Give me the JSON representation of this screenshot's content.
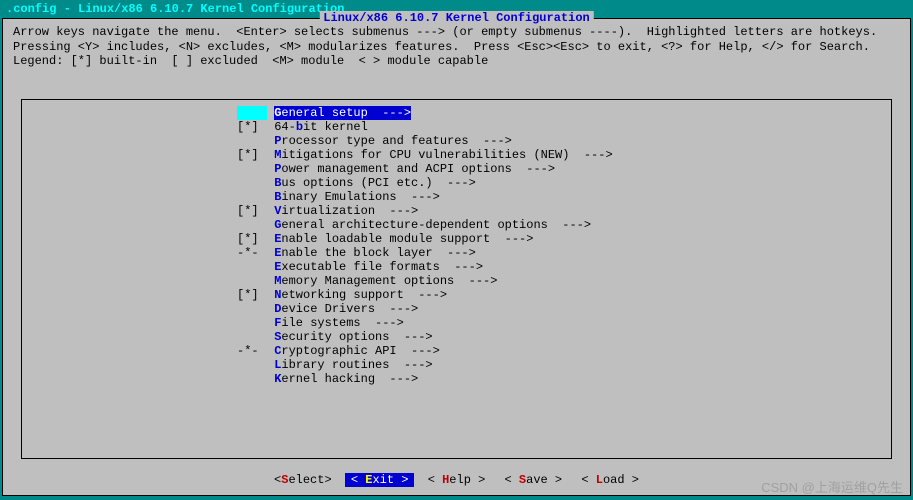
{
  "window_title": ".config - Linux/x86 6.10.7 Kernel Configuration",
  "box_title": "Linux/x86 6.10.7 Kernel Configuration",
  "help_text": "Arrow keys navigate the menu.  <Enter> selects submenus ---> (or empty submenus ----).  Highlighted letters are hotkeys.  Pressing <Y> includes, <N> excludes, <M> modularizes features.  Press <Esc><Esc> to exit, <?> for Help, </> for Search.  Legend: [*] built-in  [ ] excluded  <M> module  < > module capable",
  "menu": [
    {
      "mark": "   ",
      "hot": "G",
      "rest": "eneral setup  --->",
      "selected": true
    },
    {
      "mark": "[*]",
      "hot": "",
      "rest": "64-",
      "hot2": "b",
      "rest2": "it kernel"
    },
    {
      "mark": "   ",
      "hot": "P",
      "rest": "rocessor type and features  --->"
    },
    {
      "mark": "[*]",
      "hot": "M",
      "rest": "itigations for CPU vulnerabilities (NEW)  --->"
    },
    {
      "mark": "   ",
      "hot": "P",
      "rest": "ower management and ACPI options  --->"
    },
    {
      "mark": "   ",
      "hot": "B",
      "rest": "us options (PCI etc.)  --->"
    },
    {
      "mark": "   ",
      "hot": "B",
      "rest": "inary Emulations  --->"
    },
    {
      "mark": "[*]",
      "hot": "V",
      "rest": "irtualization  --->"
    },
    {
      "mark": "   ",
      "hot": "G",
      "rest": "eneral architecture-dependent options  --->"
    },
    {
      "mark": "[*]",
      "hot": "E",
      "rest": "nable loadable module support  --->"
    },
    {
      "mark": "-*-",
      "hot": "E",
      "rest": "nable the block layer  --->"
    },
    {
      "mark": "   ",
      "hot": "E",
      "rest": "xecutable file formats  --->"
    },
    {
      "mark": "   ",
      "hot": "M",
      "rest": "emory Management options  --->"
    },
    {
      "mark": "[*]",
      "hot": "N",
      "rest": "etworking support  --->"
    },
    {
      "mark": "   ",
      "hot": "D",
      "rest": "evice Drivers  --->"
    },
    {
      "mark": "   ",
      "hot": "F",
      "rest": "ile systems  --->"
    },
    {
      "mark": "   ",
      "hot": "S",
      "rest": "ecurity options  --->"
    },
    {
      "mark": "-*-",
      "hot": "C",
      "rest": "ryptographic API  --->"
    },
    {
      "mark": "   ",
      "hot": "L",
      "rest": "ibrary routines  --->"
    },
    {
      "mark": "   ",
      "hot": "K",
      "rest": "ernel hacking  --->"
    }
  ],
  "buttons": [
    {
      "label_pre": "<",
      "hot": "S",
      "label_post": "elect>",
      "active": false
    },
    {
      "label_pre": "< ",
      "hot": "E",
      "label_post": "xit >",
      "active": true
    },
    {
      "label_pre": "< ",
      "hot": "H",
      "label_post": "elp >",
      "active": false
    },
    {
      "label_pre": "< ",
      "hot": "S",
      "label_post": "ave >",
      "active": false
    },
    {
      "label_pre": "< ",
      "hot": "L",
      "label_post": "oad >",
      "active": false
    }
  ],
  "watermark": "CSDN @上海运维Q先生"
}
